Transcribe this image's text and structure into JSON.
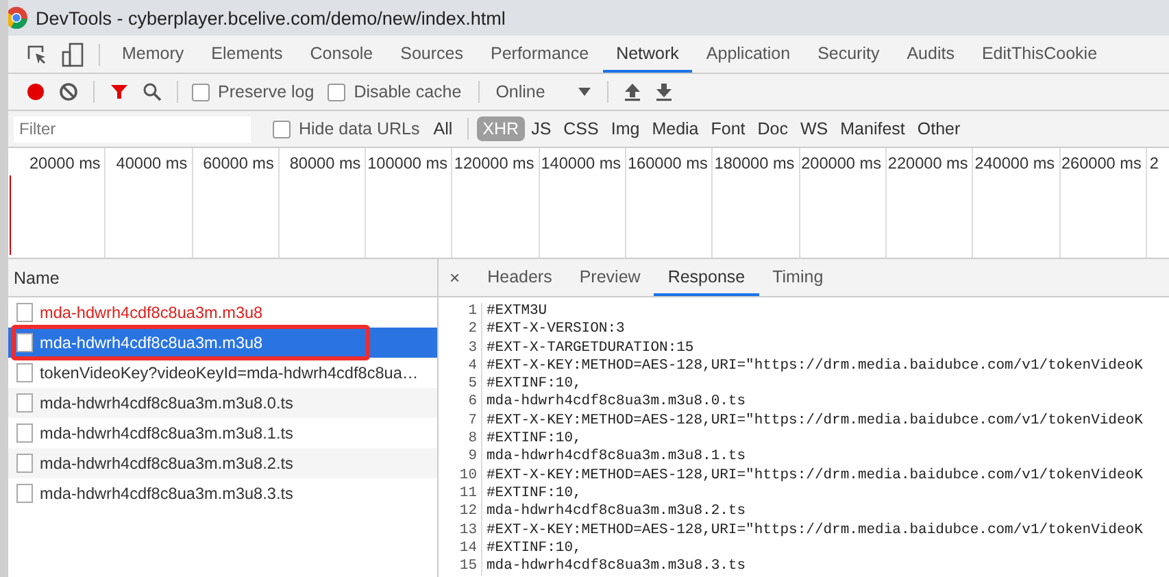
{
  "window": {
    "title": "DevTools - cyberplayer.bcelive.com/demo/new/index.html"
  },
  "panel_tabs": [
    {
      "label": "Memory",
      "selected": false
    },
    {
      "label": "Elements",
      "selected": false
    },
    {
      "label": "Console",
      "selected": false
    },
    {
      "label": "Sources",
      "selected": false
    },
    {
      "label": "Performance",
      "selected": false
    },
    {
      "label": "Network",
      "selected": true
    },
    {
      "label": "Application",
      "selected": false
    },
    {
      "label": "Security",
      "selected": false
    },
    {
      "label": "Audits",
      "selected": false
    },
    {
      "label": "EditThisCookie",
      "selected": false
    }
  ],
  "toolbar": {
    "recording": true,
    "filter_active": true,
    "preserve_log": {
      "label": "Preserve log",
      "checked": false
    },
    "disable_cache": {
      "label": "Disable cache",
      "checked": false
    },
    "throttling": "Online"
  },
  "filter_bar": {
    "placeholder": "Filter",
    "hide_data_urls": {
      "label": "Hide data URLs",
      "checked": false
    },
    "types": [
      {
        "label": "All",
        "selected": false
      },
      {
        "label": "XHR",
        "selected": true
      },
      {
        "label": "JS",
        "selected": false
      },
      {
        "label": "CSS",
        "selected": false
      },
      {
        "label": "Img",
        "selected": false
      },
      {
        "label": "Media",
        "selected": false
      },
      {
        "label": "Font",
        "selected": false
      },
      {
        "label": "Doc",
        "selected": false
      },
      {
        "label": "WS",
        "selected": false
      },
      {
        "label": "Manifest",
        "selected": false
      },
      {
        "label": "Other",
        "selected": false
      }
    ]
  },
  "timeline": {
    "ticks": [
      "20000 ms",
      "40000 ms",
      "60000 ms",
      "80000 ms",
      "100000 ms",
      "120000 ms",
      "140000 ms",
      "160000 ms",
      "180000 ms",
      "200000 ms",
      "220000 ms",
      "240000 ms",
      "260000 ms",
      "2"
    ]
  },
  "requests": {
    "column": "Name",
    "rows": [
      {
        "name": "mda-hdwrh4cdf8c8ua3m.m3u8",
        "failed": true,
        "selected": false
      },
      {
        "name": "mda-hdwrh4cdf8c8ua3m.m3u8",
        "failed": false,
        "selected": true
      },
      {
        "name": "tokenVideoKey?videoKeyId=mda-hdwrh4cdf8c8ua…",
        "failed": false,
        "selected": false
      },
      {
        "name": "mda-hdwrh4cdf8c8ua3m.m3u8.0.ts",
        "failed": false,
        "selected": false
      },
      {
        "name": "mda-hdwrh4cdf8c8ua3m.m3u8.1.ts",
        "failed": false,
        "selected": false
      },
      {
        "name": "mda-hdwrh4cdf8c8ua3m.m3u8.2.ts",
        "failed": false,
        "selected": false
      },
      {
        "name": "mda-hdwrh4cdf8c8ua3m.m3u8.3.ts",
        "failed": false,
        "selected": false
      }
    ]
  },
  "details": {
    "close": "×",
    "tabs": [
      {
        "label": "Headers",
        "selected": false
      },
      {
        "label": "Preview",
        "selected": false
      },
      {
        "label": "Response",
        "selected": true
      },
      {
        "label": "Timing",
        "selected": false
      }
    ],
    "lines": [
      {
        "number": "1",
        "text": "#EXTM3U"
      },
      {
        "number": "2",
        "text": "#EXT-X-VERSION:3"
      },
      {
        "number": "3",
        "text": "#EXT-X-TARGETDURATION:15"
      },
      {
        "number": "4",
        "text": "#EXT-X-KEY:METHOD=AES-128,URI=\"https://drm.media.baidubce.com/v1/tokenVideoK"
      },
      {
        "number": "5",
        "text": "#EXTINF:10,"
      },
      {
        "number": "6",
        "text": "mda-hdwrh4cdf8c8ua3m.m3u8.0.ts"
      },
      {
        "number": "7",
        "text": "#EXT-X-KEY:METHOD=AES-128,URI=\"https://drm.media.baidubce.com/v1/tokenVideoK"
      },
      {
        "number": "8",
        "text": "#EXTINF:10,"
      },
      {
        "number": "9",
        "text": "mda-hdwrh4cdf8c8ua3m.m3u8.1.ts"
      },
      {
        "number": "10",
        "text": "#EXT-X-KEY:METHOD=AES-128,URI=\"https://drm.media.baidubce.com/v1/tokenVideoK"
      },
      {
        "number": "11",
        "text": "#EXTINF:10,"
      },
      {
        "number": "12",
        "text": "mda-hdwrh4cdf8c8ua3m.m3u8.2.ts"
      },
      {
        "number": "13",
        "text": "#EXT-X-KEY:METHOD=AES-128,URI=\"https://drm.media.baidubce.com/v1/tokenVideoK"
      },
      {
        "number": "14",
        "text": "#EXTINF:10,"
      },
      {
        "number": "15",
        "text": "mda-hdwrh4cdf8c8ua3m.m3u8.3.ts"
      }
    ]
  }
}
